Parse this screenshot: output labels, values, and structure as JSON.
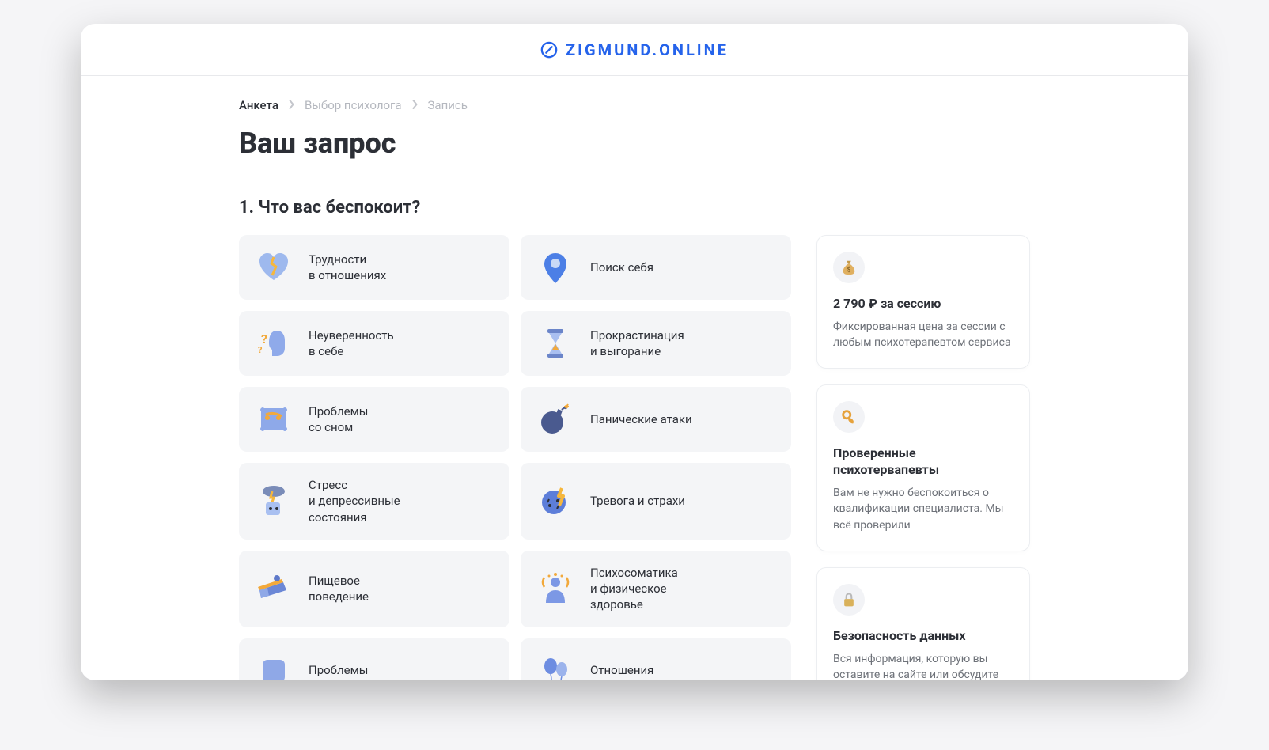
{
  "brand": "ZIGMUND.ONLINE",
  "breadcrumb": {
    "items": [
      "Анкета",
      "Выбор психолога",
      "Запись"
    ],
    "activeIndex": 0
  },
  "title": "Ваш запрос",
  "question": "1. Что вас беспокоит?",
  "options": [
    {
      "label": "Трудности\nв отношениях",
      "icon": "broken-heart-icon"
    },
    {
      "label": "Поиск себя",
      "icon": "pin-icon"
    },
    {
      "label": "Неуверенность\nв себе",
      "icon": "question-person-icon"
    },
    {
      "label": "Прокрастинация\nи выгорание",
      "icon": "hourglass-icon"
    },
    {
      "label": "Проблемы\nсо сном",
      "icon": "pillow-icon"
    },
    {
      "label": "Панические атаки",
      "icon": "bomb-icon"
    },
    {
      "label": "Стресс\nи депрессивные\nсостояния",
      "icon": "storm-head-icon"
    },
    {
      "label": "Тревога и страхи",
      "icon": "planet-bolt-icon"
    },
    {
      "label": "Пищевое\nповедение",
      "icon": "cake-icon"
    },
    {
      "label": "Психосоматика\nи физическое\nздоровье",
      "icon": "body-aura-icon"
    },
    {
      "label": "Проблемы",
      "icon": "generic-icon"
    },
    {
      "label": "Отношения",
      "icon": "balloons-icon"
    }
  ],
  "sidebar": [
    {
      "icon": "money-bag-icon",
      "title": "2 790 ₽ за сессию",
      "text": "Фиксированная цена за сессии с любым психотерапевтом сервиса"
    },
    {
      "icon": "ok-hand-icon",
      "title": "Проверенные психотервапевты",
      "text": "Вам не нужно беспокоиться о квалификации специалиста. Мы всё проверили"
    },
    {
      "icon": "lock-icon",
      "title": "Безопасность данных",
      "text": "Вся информация, которую вы оставите на сайте или обсудите"
    }
  ]
}
